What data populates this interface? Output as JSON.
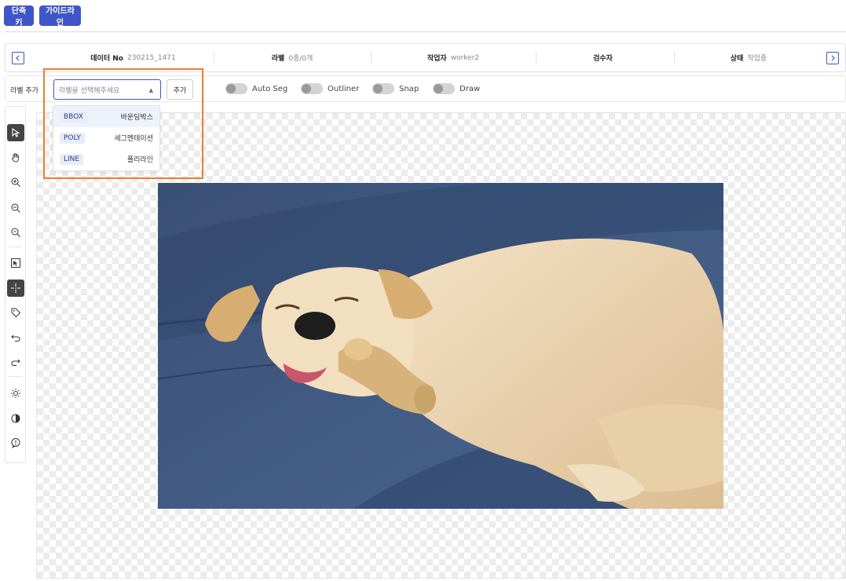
{
  "top_buttons": {
    "shortcut": "단축키",
    "guideline": "가이드라인"
  },
  "info_bar": {
    "data_no_label": "데이터 No",
    "data_no_value": "230215_1471",
    "label_label": "라벨",
    "label_value": "0종/0개",
    "worker_label": "작업자",
    "worker_value": "worker2",
    "inspector_label": "검수자",
    "inspector_value": "",
    "status_label": "상태",
    "status_value": "작업중",
    "prev_icon": "chevron-left-icon",
    "next_icon": "chevron-right-icon"
  },
  "toolbar": {
    "add_label_text": "라벨 추가",
    "select_placeholder": "라벨을 선택해주세요",
    "add_button": "추가",
    "toggles": [
      {
        "label": "Auto Seg",
        "on": false
      },
      {
        "label": "Outliner",
        "on": false
      },
      {
        "label": "Snap",
        "on": false
      },
      {
        "label": "Draw",
        "on": false
      }
    ]
  },
  "dropdown": {
    "items": [
      {
        "tag": "BBOX",
        "text": "바운딩박스",
        "highlighted": true
      },
      {
        "tag": "POLY",
        "text": "세그멘테이션",
        "highlighted": false
      },
      {
        "tag": "LINE",
        "text": "폴리라인",
        "highlighted": false
      }
    ]
  },
  "left_tools": [
    {
      "icon": "pointer-icon",
      "active": true
    },
    {
      "icon": "hand-icon",
      "active": false
    },
    {
      "icon": "zoom-in-icon",
      "active": false
    },
    {
      "icon": "zoom-out-icon",
      "active": false
    },
    {
      "icon": "zoom-fit-icon",
      "active": false
    },
    {
      "icon": "select-box-icon",
      "active": false
    },
    {
      "icon": "crosshair-icon",
      "active": true
    },
    {
      "icon": "tag-icon",
      "active": false
    },
    {
      "icon": "undo-icon",
      "active": false
    },
    {
      "icon": "redo-icon",
      "active": false
    },
    {
      "icon": "brightness-icon",
      "active": false
    },
    {
      "icon": "contrast-icon",
      "active": false
    },
    {
      "icon": "info-icon",
      "active": false
    }
  ],
  "colors": {
    "accent": "#3f55c8",
    "highlight_border": "#ed7d31",
    "sofa": "#3e5579",
    "dog": "#e9d2b0"
  }
}
